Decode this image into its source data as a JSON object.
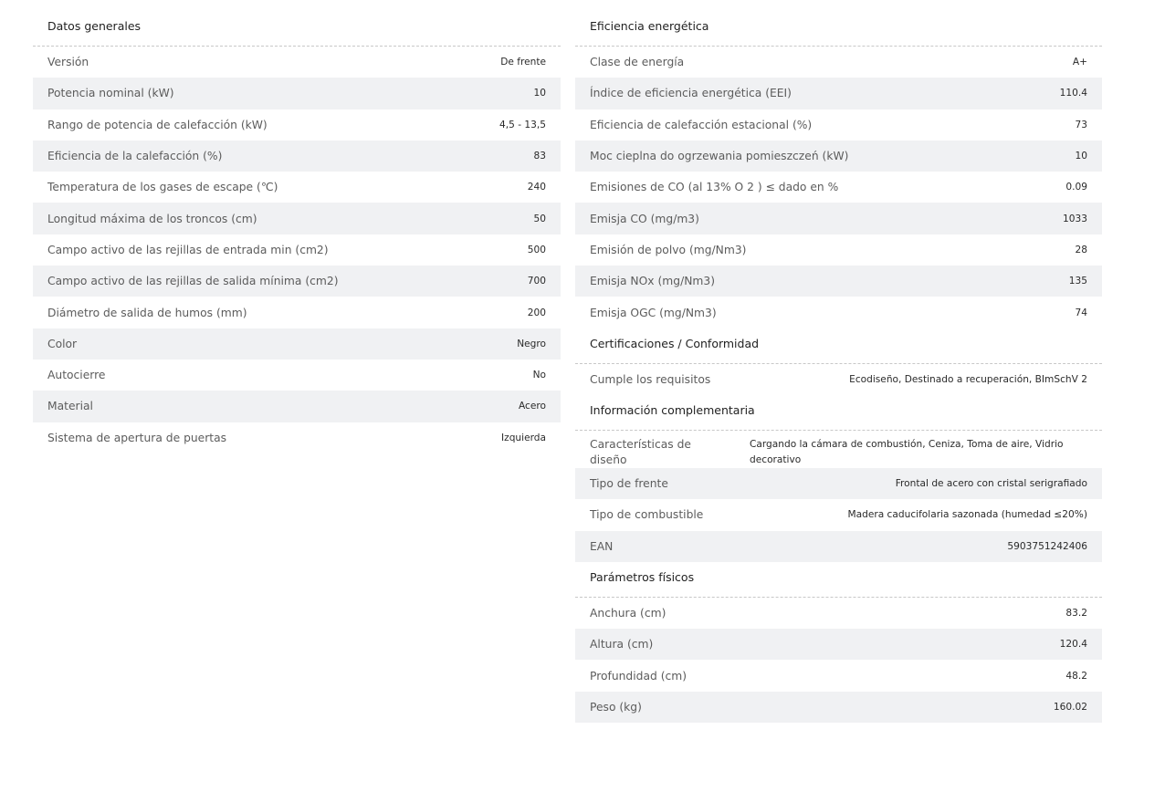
{
  "general": {
    "title": "Datos generales",
    "rows": [
      {
        "label": "Versión",
        "value": "De frente"
      },
      {
        "label": "Potencia nominal (kW)",
        "value": "10"
      },
      {
        "label": "Rango de potencia de calefacción (kW)",
        "value": "4,5 - 13,5"
      },
      {
        "label": "Eficiencia de la calefacción (%)",
        "value": "83"
      },
      {
        "label": "Temperatura de los gases de escape (℃)",
        "value": "240"
      },
      {
        "label": "Longitud máxima de los troncos (cm)",
        "value": "50"
      },
      {
        "label": "Campo activo de las rejillas de entrada min (cm2)",
        "value": "500"
      },
      {
        "label": "Campo activo de las rejillas de salida mínima (cm2)",
        "value": "700"
      },
      {
        "label": "Diámetro de salida de humos (mm)",
        "value": "200"
      },
      {
        "label": "Color",
        "value": "Negro"
      },
      {
        "label": "Autocierre",
        "value": "No"
      },
      {
        "label": "Material",
        "value": "Acero"
      },
      {
        "label": "Sistema de apertura de puertas",
        "value": "Izquierda"
      }
    ]
  },
  "energy": {
    "title": "Eficiencia energética",
    "rows": [
      {
        "label": "Clase de energía",
        "value": "A+"
      },
      {
        "label": "Índice de eficiencia energética (EEI)",
        "value": "110.4"
      },
      {
        "label": "Eficiencia de calefacción estacional (%)",
        "value": "73"
      },
      {
        "label": "Moc cieplna do ogrzewania pomieszczeń (kW)",
        "value": "10"
      },
      {
        "label": "Emisiones de CO (al 13% O 2 ) ≤ dado en %",
        "value": "0.09"
      },
      {
        "label": "Emisja CO (mg/m3)",
        "value": "1033"
      },
      {
        "label": "Emisión de polvo (mg/Nm3)",
        "value": "28"
      },
      {
        "label": "Emisja NOx (mg/Nm3)",
        "value": "135"
      },
      {
        "label": "Emisja OGC (mg/Nm3)",
        "value": "74"
      }
    ]
  },
  "certifications": {
    "title": "Certificaciones / Conformidad",
    "rows": [
      {
        "label": "Cumple los requisitos",
        "value": "Ecodiseño, Destinado a recuperación, BImSchV 2"
      }
    ]
  },
  "additional": {
    "title": "Información complementaria",
    "rows": [
      {
        "label": "Características de diseño",
        "value": "Cargando la cámara de combustión, Ceniza, Toma de aire, Vidrio decorativo"
      },
      {
        "label": "Tipo de frente",
        "value": "Frontal de acero con cristal serigrafiado"
      },
      {
        "label": "Tipo de combustible",
        "value": "Madera caducifolaria sazonada (humedad ≤20%)"
      },
      {
        "label": "EAN",
        "value": "5903751242406"
      }
    ]
  },
  "physical": {
    "title": "Parámetros físicos",
    "rows": [
      {
        "label": "Anchura (cm)",
        "value": "83.2"
      },
      {
        "label": "Altura (cm)",
        "value": "120.4"
      },
      {
        "label": "Profundidad (cm)",
        "value": "48.2"
      },
      {
        "label": "Peso (kg)",
        "value": "160.02"
      }
    ]
  }
}
